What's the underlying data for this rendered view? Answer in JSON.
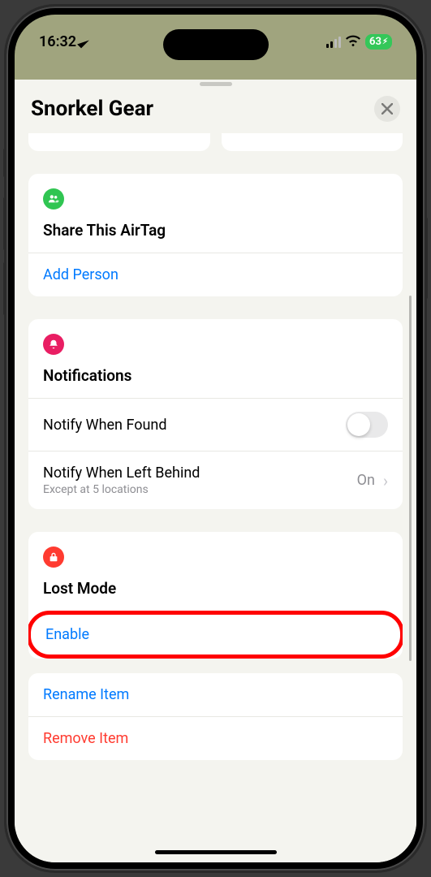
{
  "status": {
    "time": "16:32",
    "battery": "63"
  },
  "sheet": {
    "title": "Snorkel Gear"
  },
  "share": {
    "title": "Share This AirTag",
    "addPerson": "Add Person"
  },
  "notifications": {
    "title": "Notifications",
    "notifyFound": "Notify When Found",
    "notifyLeft": "Notify When Left Behind",
    "notifyLeftSub": "Except at 5 locations",
    "notifyLeftValue": "On"
  },
  "lostMode": {
    "title": "Lost Mode",
    "enable": "Enable"
  },
  "actions": {
    "rename": "Rename Item",
    "remove": "Remove Item"
  }
}
